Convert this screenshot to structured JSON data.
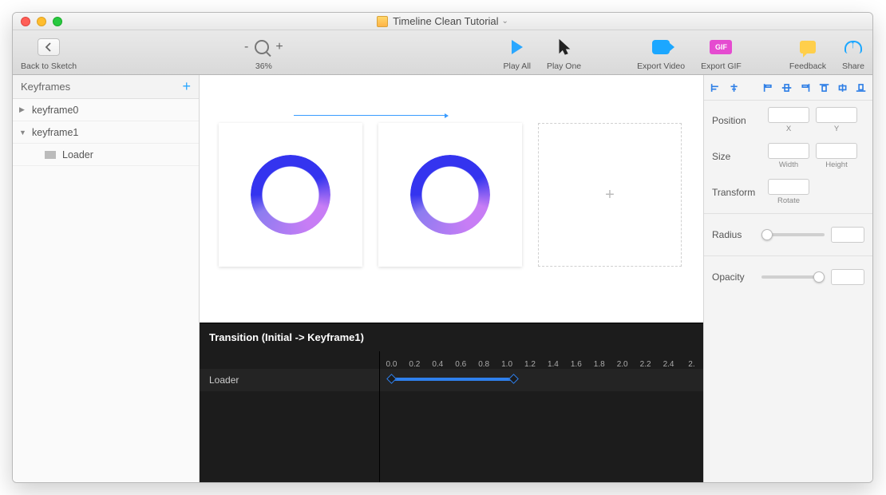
{
  "window": {
    "title": "Timeline Clean Tutorial"
  },
  "toolbar": {
    "back_label": "Back to Sketch",
    "zoom": {
      "minus": "-",
      "plus": "+",
      "level": "36%"
    },
    "play_all": "Play All",
    "play_one": "Play One",
    "export_video": "Export Video",
    "export_gif": "Export GIF",
    "gif_badge": "GIF",
    "feedback": "Feedback",
    "share": "Share"
  },
  "sidebar_left": {
    "header": "Keyframes",
    "items": [
      {
        "label": "keyframe0",
        "expanded": false
      },
      {
        "label": "keyframe1",
        "expanded": true,
        "children": [
          {
            "label": "Loader"
          }
        ]
      }
    ]
  },
  "canvas": {
    "empty_plus": "+"
  },
  "timeline": {
    "title": "Transition (Initial -> Keyframe1)",
    "track_label": "Loader",
    "ticks": [
      "0.0",
      "0.2",
      "0.4",
      "0.6",
      "0.8",
      "1.0",
      "1.2",
      "1.4",
      "1.6",
      "1.8",
      "2.0",
      "2.2",
      "2.4",
      "2."
    ],
    "clip": {
      "start": 0.0,
      "end": 1.0
    }
  },
  "inspector": {
    "position": {
      "label": "Position",
      "x_label": "X",
      "y_label": "Y",
      "x": "",
      "y": ""
    },
    "size": {
      "label": "Size",
      "w_label": "Width",
      "h_label": "Height",
      "w": "",
      "h": ""
    },
    "transform": {
      "label": "Transform",
      "rotate_label": "Rotate",
      "rotate": ""
    },
    "radius": {
      "label": "Radius",
      "value": ""
    },
    "opacity": {
      "label": "Opacity",
      "value": ""
    }
  }
}
